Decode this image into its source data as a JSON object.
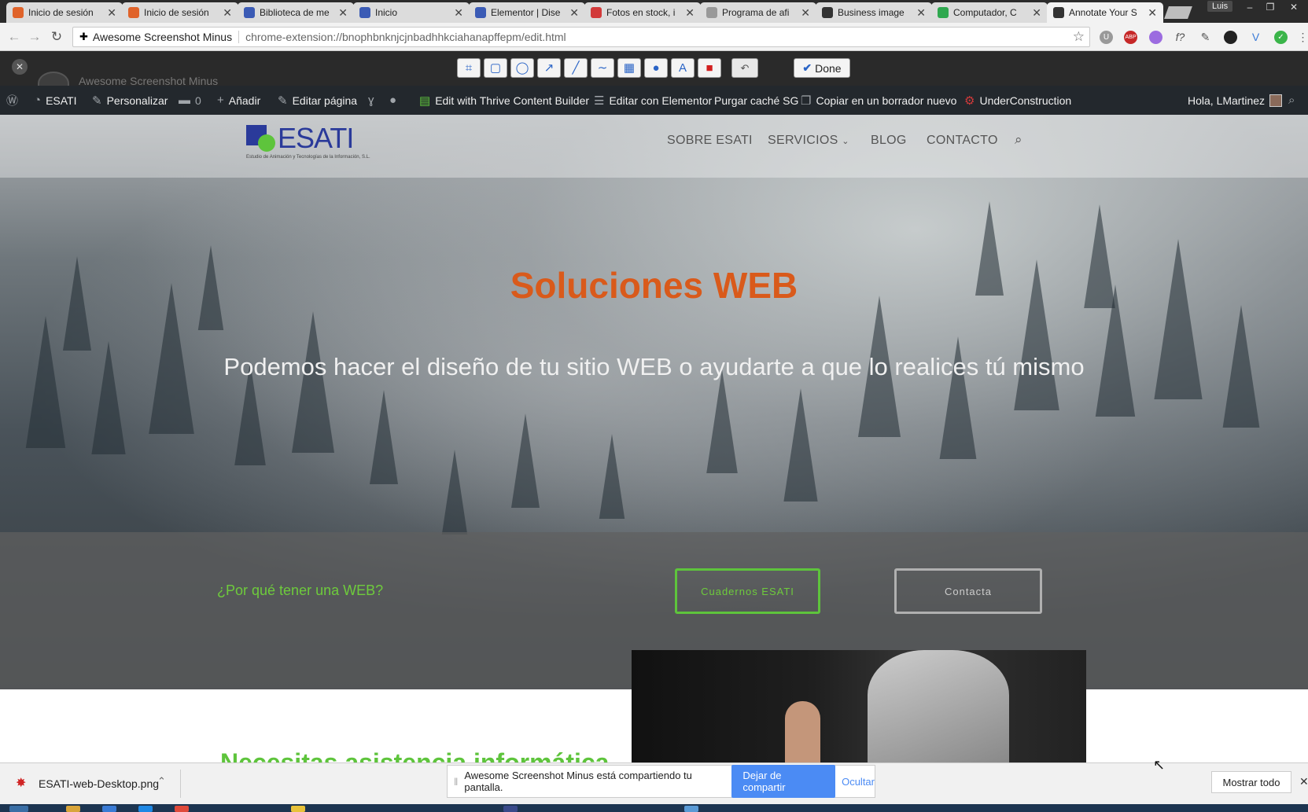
{
  "browser": {
    "tabs": [
      {
        "title": "Inicio de sesión",
        "color": "#e0632a",
        "active": false
      },
      {
        "title": "Inicio de sesión",
        "color": "#e0632a",
        "active": false
      },
      {
        "title": "Biblioteca de me",
        "color": "#3b5bb5",
        "active": false
      },
      {
        "title": "Inicio",
        "color": "#3b5bb5",
        "active": false
      },
      {
        "title": "Elementor | Dise",
        "color": "#3b5bb5",
        "active": false
      },
      {
        "title": "Fotos en stock, i",
        "color": "#d23a3a",
        "active": false
      },
      {
        "title": "Programa de afi",
        "color": "#999999",
        "active": false
      },
      {
        "title": "Business image",
        "color": "#333333",
        "active": false
      },
      {
        "title": "Computador, C",
        "color": "#2fa84f",
        "active": false
      },
      {
        "title": "Annotate Your S",
        "color": "#333333",
        "active": true
      }
    ],
    "profile": "Luis",
    "omnibox_label": "Awesome Screenshot Minus",
    "url": "chrome-extension://bnophbnknjcjnbadhhkciahanapffepm/edit.html"
  },
  "annotate": {
    "brand": "Awesome Screenshot Minus",
    "tools": [
      {
        "icon": "crop-icon",
        "glyph": "⌗"
      },
      {
        "icon": "rectangle-icon",
        "glyph": "▢"
      },
      {
        "icon": "ellipse-icon",
        "glyph": "◯"
      },
      {
        "icon": "arrow-icon",
        "glyph": "↗"
      },
      {
        "icon": "line-icon",
        "glyph": "╱"
      },
      {
        "icon": "curve-icon",
        "glyph": "∼"
      },
      {
        "icon": "blur-icon",
        "glyph": "▦"
      },
      {
        "icon": "drop-icon",
        "glyph": "●"
      },
      {
        "icon": "text-icon",
        "glyph": "A"
      },
      {
        "icon": "color-icon",
        "glyph": "■"
      }
    ],
    "done_label": "Done"
  },
  "wpbar": {
    "site": "ESATI",
    "customize": "Personalizar",
    "comments": "0",
    "add": "Añadir",
    "edit_page": "Editar página",
    "thrive": "Edit with Thrive Content Builder",
    "elementor": "Editar con Elementor",
    "purge": "Purgar caché SG",
    "copy_draft": "Copiar en un borrador nuevo",
    "under_construction": "UnderConstruction",
    "greeting": "Hola, LMartinez"
  },
  "site": {
    "logo_text": "ESATI",
    "logo_tagline": "Estudio de Animación y Tecnologías de la Información, S.L.",
    "menu": [
      "SOBRE ESATI",
      "SERVICIOS",
      "BLOG",
      "CONTACTO"
    ],
    "hero_title": "Soluciones WEB",
    "hero_subtitle": "Podemos hacer el diseño de tu sitio WEB o ayudarte a que lo realices tú mismo",
    "why_link": "¿Por qué tener una WEB?",
    "btn_cuadernos": "Cuadernos ESATI",
    "btn_contacta": "Contacta",
    "section_heading": "Necesitas asistencia informática"
  },
  "downloads": {
    "file": "ESATI-web-Desktop.png",
    "share_text": "Awesome Screenshot Minus está compartiendo tu pantalla.",
    "stop_label": "Dejar de compartir",
    "hide_label": "Ocultar",
    "show_all": "Mostrar todo"
  },
  "colors": {
    "accent_orange": "#d95a1b",
    "accent_green": "#5ec43c",
    "wp_bar": "#23282d"
  }
}
